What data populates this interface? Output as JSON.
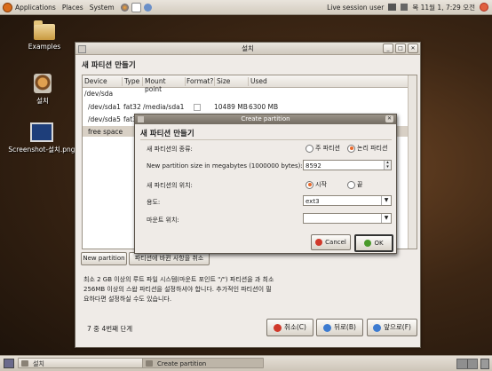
{
  "top_panel": {
    "menus": [
      "Applications",
      "Places",
      "System"
    ],
    "session_label": "Live session user",
    "clock": "목 11월  1,  7:29 오전"
  },
  "desktop_icons": [
    {
      "label": "Examples",
      "icon": "folder-icon"
    },
    {
      "label": "설치",
      "icon": "installer-icon"
    },
    {
      "label": "Screenshot-설치.png",
      "icon": "image-file-icon"
    }
  ],
  "installer": {
    "title": "설치",
    "heading": "새 파티션 만들기",
    "columns": [
      "Device",
      "Type",
      "Mount point",
      "Format?",
      "Size",
      "Used"
    ],
    "rows": [
      {
        "device": "/dev/sda",
        "type": "",
        "mount": "",
        "format": "",
        "size": "",
        "used": ""
      },
      {
        "device": "/dev/sda1",
        "type": "fat32",
        "mount": "/media/sda1",
        "format": "",
        "size": "10489 MB",
        "used": "6300 MB"
      },
      {
        "device": "/dev/sda5",
        "type": "fat3",
        "mount": "",
        "format": "",
        "size": "",
        "used": ""
      },
      {
        "device": "free space",
        "type": "",
        "mount": "",
        "format": "",
        "size": "",
        "used": ""
      }
    ],
    "new_partition_button": "New partition",
    "undo_button": "파티션에 바뀐 사항을 취소",
    "info_text": "최소 2 GB 이상의 루트 파일 시스템(마운트 포인트 \"/\") 파티션을 과 최소 256MB 이상의 스왑 파티션을 설정하셔야 합니다. 추가적인 파티션이 필요하다면 설정하실 수도 있습니다.",
    "step_text": "7 중 4번째 단계",
    "cancel_button": "취소(C)",
    "back_button": "뒤로(B)",
    "forward_button": "앞으로(F)"
  },
  "dialog": {
    "title": "Create partition",
    "heading": "새 파티션 만들기",
    "type_label": "새 파티션의 종류:",
    "type_primary": "주 파티션",
    "type_logical": "논리 파티션",
    "size_label": "New partition size in megabytes (1000000 bytes):",
    "size_value": "8592",
    "location_label": "새 파티션의 위치:",
    "loc_start": "시작",
    "loc_end": "끝",
    "use_label": "용도:",
    "use_value": "ext3",
    "mount_label": "마운트 위치:",
    "mount_value": "",
    "cancel_button": "Cancel",
    "ok_button": "OK"
  },
  "taskbar": {
    "tasks": [
      "설치",
      "Create partition"
    ]
  },
  "colors": {
    "accent": "#e8692b",
    "panel": "#d8d1c6",
    "selection": "#d8d0c5"
  }
}
